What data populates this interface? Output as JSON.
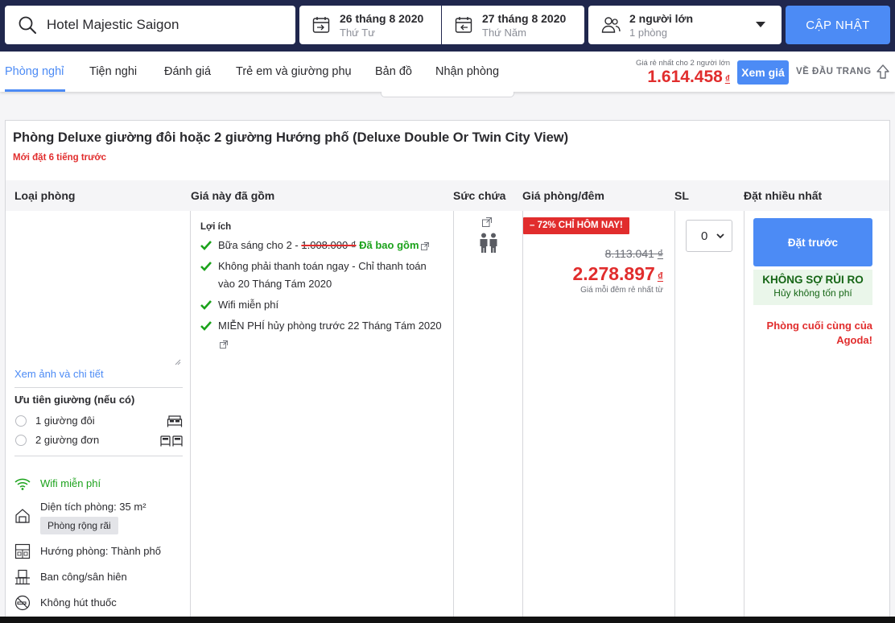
{
  "search": {
    "query": "Hotel Majestic Saigon"
  },
  "checkin": {
    "date": "26 tháng 8 2020",
    "weekday": "Thứ Tư"
  },
  "checkout": {
    "date": "27 tháng 8 2020",
    "weekday": "Thứ Năm"
  },
  "guests": {
    "adults": "2 người lớn",
    "rooms": "1 phòng"
  },
  "update_label": "CẬP NHẬT",
  "tabs": [
    {
      "label": "Phòng nghỉ",
      "active": true
    },
    {
      "label": "Tiện nghi"
    },
    {
      "label": "Đánh giá"
    },
    {
      "label": "Trẻ em và giường phụ"
    },
    {
      "label": "Bản đồ"
    },
    {
      "label": "Nhận phòng"
    }
  ],
  "cheapest": {
    "label": "Giá rẻ nhất cho 2 người lớn",
    "price": "1.614.458",
    "currency": "₫"
  },
  "view_price_label": "Xem giá",
  "back_to_top_label": "VỀ ĐẦU TRANG",
  "room": {
    "title": "Phòng Deluxe giường đôi hoặc 2 giường Hướng phố (Deluxe Double Or Twin City View)",
    "booked_note": "Mới đặt 6 tiếng trước",
    "columns": {
      "room_type": "Loại phòng",
      "included": "Giá này đã gồm",
      "capacity": "Sức chứa",
      "price": "Giá phòng/đêm",
      "qty": "SL",
      "most_booked": "Đặt nhiều nhất"
    },
    "detail_link": "Xem ảnh và chi tiết",
    "bed_pref_title": "Ưu tiên giường (nếu có)",
    "bed_options": [
      "1 giường đôi",
      "2 giường đơn"
    ],
    "features": {
      "wifi": "Wifi miễn phí",
      "area": "Diện tích phòng: 35 m²",
      "area_badge": "Phòng rộng rãi",
      "view": "Hướng phòng: Thành phố",
      "balcony": "Ban công/sân hiên",
      "nosmoking": "Không hút thuốc"
    },
    "benefits_title": "Lợi ích",
    "benefits": {
      "breakfast_prefix": "Bữa sáng cho 2 - ",
      "breakfast_old_price": "1.008.000 ₫",
      "breakfast_included": "Đã bao gồm",
      "pay_later": "Không phải thanh toán ngay - Chỉ thanh toán vào 20 Tháng Tám 2020",
      "wifi": "Wifi miễn phí",
      "free_cancel": "MIỄN PHÍ hủy phòng trước 22 Tháng Tám 2020"
    },
    "deal_tag": "– 72% CHỈ HÔM NAY!",
    "original_price": "8.113.041",
    "price": "2.278.897",
    "currency": "₫",
    "price_note": "Giá mỗi đêm rẻ nhất từ",
    "qty_value": "0",
    "book_label": "Đặt trước",
    "no_risk_title": "KHÔNG SỢ RỦI RO",
    "no_risk_sub": "Hủy không tốn phí",
    "last_room": "Phòng cuối cùng của Agoda!"
  }
}
